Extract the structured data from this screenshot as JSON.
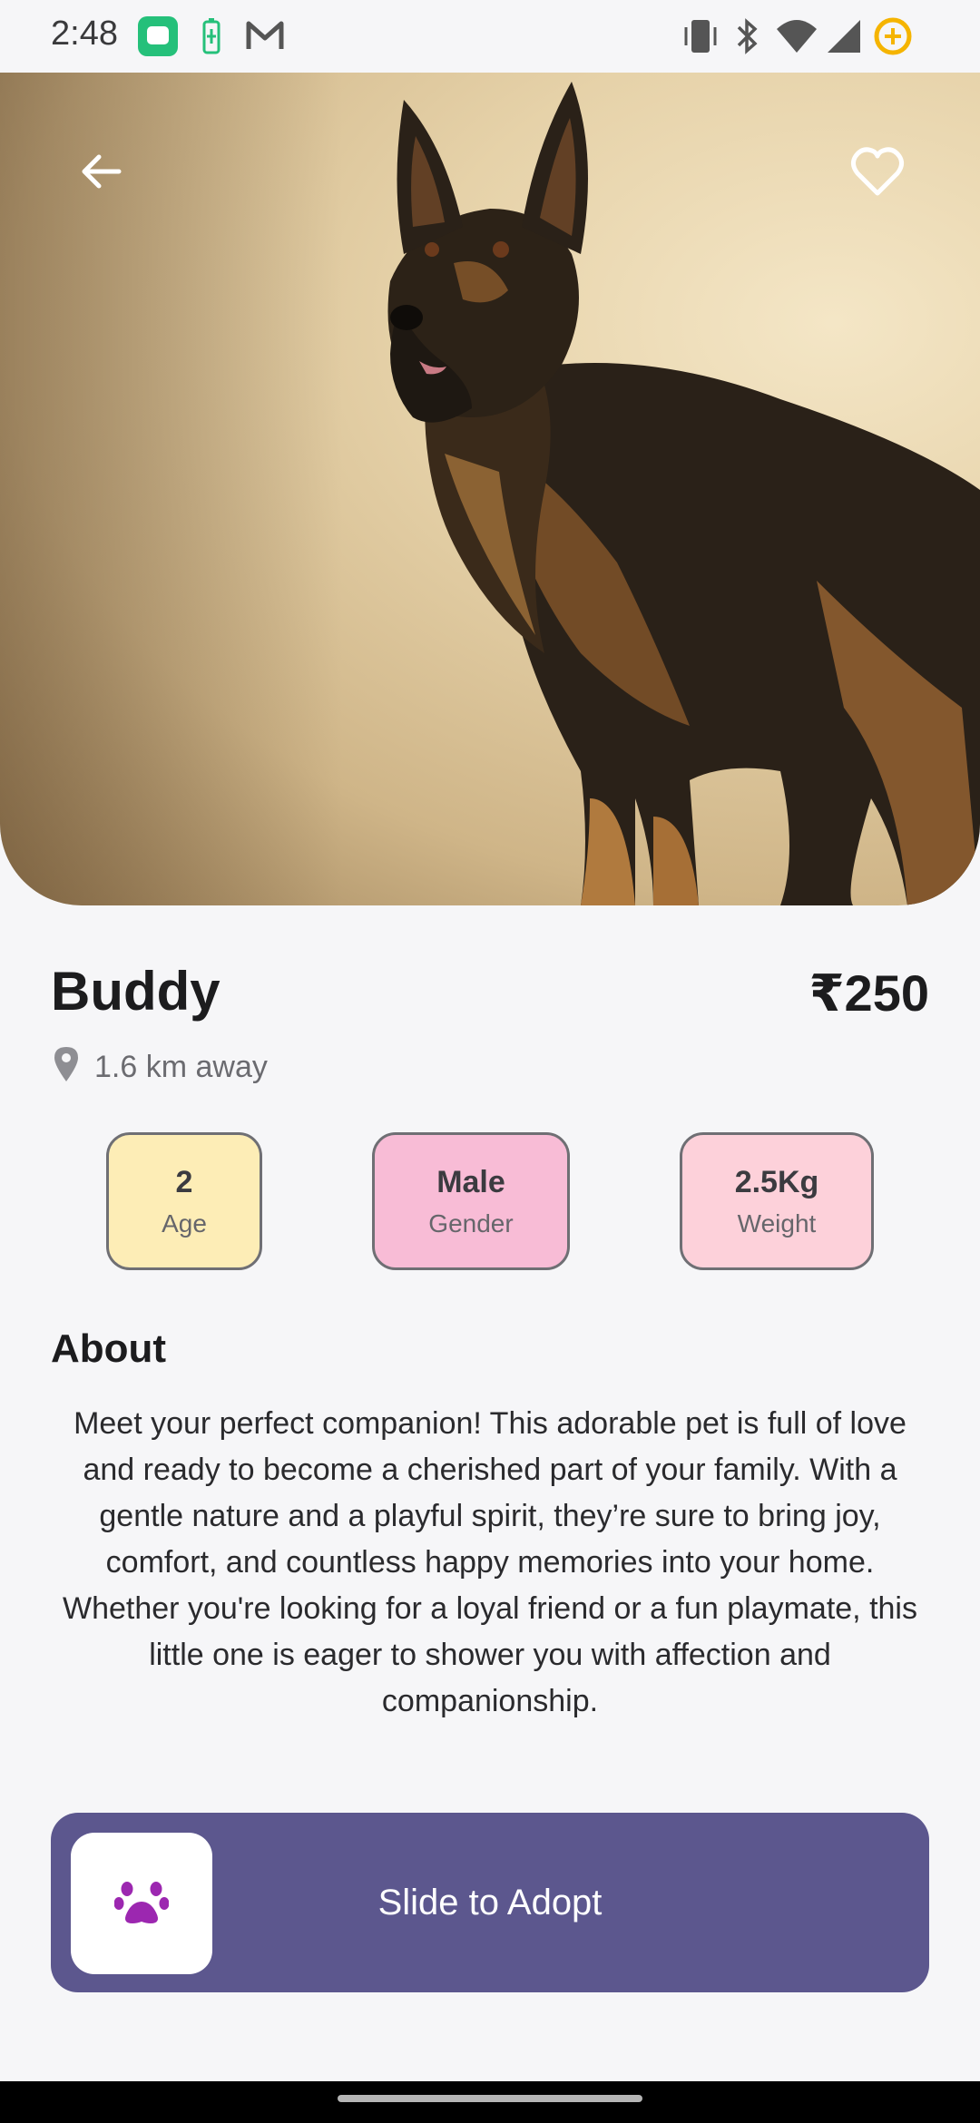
{
  "status_bar": {
    "time": "2:48",
    "left_icons": [
      "message-app-icon",
      "battery-saver-icon",
      "gmail-icon"
    ],
    "right_icons": [
      "vibrate-icon",
      "bluetooth-icon",
      "wifi-icon",
      "cellular-signal-icon",
      "data-saver-icon"
    ]
  },
  "hero": {
    "back_icon": "arrow-back-icon",
    "favorite_icon": "heart-outline-icon",
    "image": "german-shepherd-dog-photo"
  },
  "pet": {
    "name": "Buddy",
    "price": "₹250",
    "distance": "1.6 km away",
    "stats": [
      {
        "value": "2",
        "label": "Age",
        "color": "#fdedb6"
      },
      {
        "value": "Male",
        "label": "Gender",
        "color": "#f8bcd6"
      },
      {
        "value": "2.5Kg",
        "label": "Weight",
        "color": "#fdd1da"
      }
    ]
  },
  "about": {
    "title": "About",
    "text": "Meet your perfect companion! This adorable pet is full of love and ready to become a cherished part of your family. With a gentle nature and a playful spirit, they’re sure to bring joy, comfort, and countless happy memories into your home. Whether you're looking for a loyal friend or a fun playmate, this little one is eager to shower you with affection and companionship."
  },
  "adopt": {
    "label": "Slide to Adopt",
    "handle_icon": "paw-icon",
    "accent": "#5c578e",
    "paw_color": "#9c27b0"
  }
}
